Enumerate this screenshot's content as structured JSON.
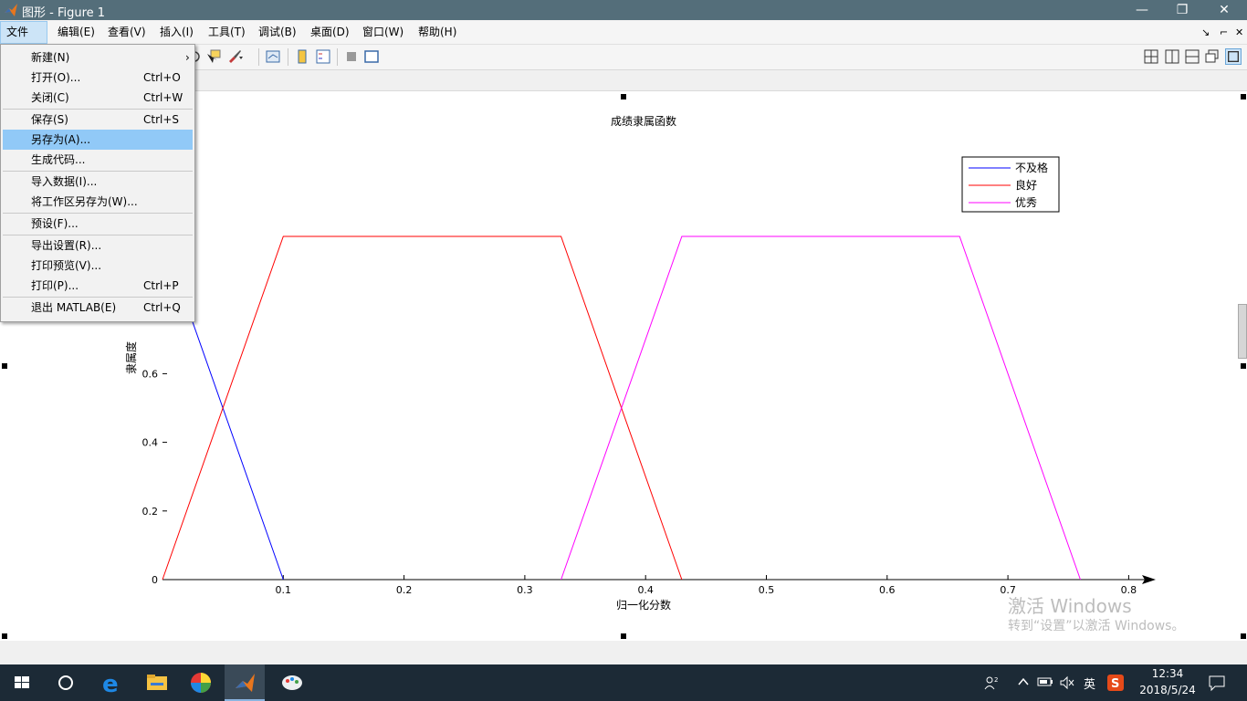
{
  "window": {
    "title": "图形 - Figure 1",
    "controls": {
      "minimize": "—",
      "restore": "❐",
      "close": "✕"
    }
  },
  "menubar": {
    "items": [
      "文件(F)",
      "编辑(E)",
      "查看(V)",
      "插入(I)",
      "工具(T)",
      "调试(B)",
      "桌面(D)",
      "窗口(W)",
      "帮助(H)"
    ],
    "right_icons": [
      "↘",
      "⌐",
      "✕"
    ]
  },
  "file_menu": {
    "items": [
      {
        "label": "新建(N)",
        "shortcut": "",
        "submenu": "›"
      },
      {
        "label": "打开(O)...",
        "shortcut": "Ctrl+O"
      },
      {
        "label": "关闭(C)",
        "shortcut": "Ctrl+W"
      },
      {
        "label": "保存(S)",
        "shortcut": "Ctrl+S"
      },
      {
        "label": "另存为(A)...",
        "shortcut": "",
        "highlighted": true
      },
      {
        "label": "生成代码...",
        "shortcut": ""
      },
      {
        "label": "导入数据(I)...",
        "shortcut": ""
      },
      {
        "label": "将工作区另存为(W)...",
        "shortcut": ""
      },
      {
        "label": "预设(F)...",
        "shortcut": ""
      },
      {
        "label": "导出设置(R)...",
        "shortcut": ""
      },
      {
        "label": "打印预览(V)...",
        "shortcut": ""
      },
      {
        "label": "打印(P)...",
        "shortcut": "Ctrl+P"
      },
      {
        "label": "退出 MATLAB(E)",
        "shortcut": "Ctrl+Q"
      }
    ]
  },
  "chart_data": {
    "type": "line",
    "title": "成绩隶属函数",
    "xlabel": "归一化分数",
    "ylabel": "隶属度",
    "xlim": [
      0,
      0.8
    ],
    "ylim": [
      0,
      1
    ],
    "xticks": [
      "0.1",
      "0.2",
      "0.3",
      "0.4",
      "0.5",
      "0.6",
      "0.7",
      "0.8"
    ],
    "yticks": [
      "0",
      "0.2",
      "0.4",
      "0.6"
    ],
    "legend_position": "top-right",
    "series": [
      {
        "name": "不及格",
        "color": "#0000ff",
        "x": [
          0,
          0.1
        ],
        "y": [
          1,
          0
        ]
      },
      {
        "name": "良好",
        "color": "#ff0000",
        "x": [
          0,
          0.1,
          0.33,
          0.43
        ],
        "y": [
          0,
          1,
          1,
          0
        ]
      },
      {
        "name": "优秀",
        "color": "#ff00ff",
        "x": [
          0.33,
          0.43,
          0.66,
          0.76
        ],
        "y": [
          0,
          1,
          1,
          0
        ]
      }
    ]
  },
  "watermark": {
    "line1": "激活 Windows",
    "line2": "转到“设置”以激活 Windows。"
  },
  "taskbar": {
    "time": "12:34",
    "date": "2018/5/24",
    "ime": "英"
  },
  "colors": {
    "titlebar": "#546e7a",
    "menu_highlight": "#91c9f7",
    "taskbar": "#1c2a36"
  }
}
